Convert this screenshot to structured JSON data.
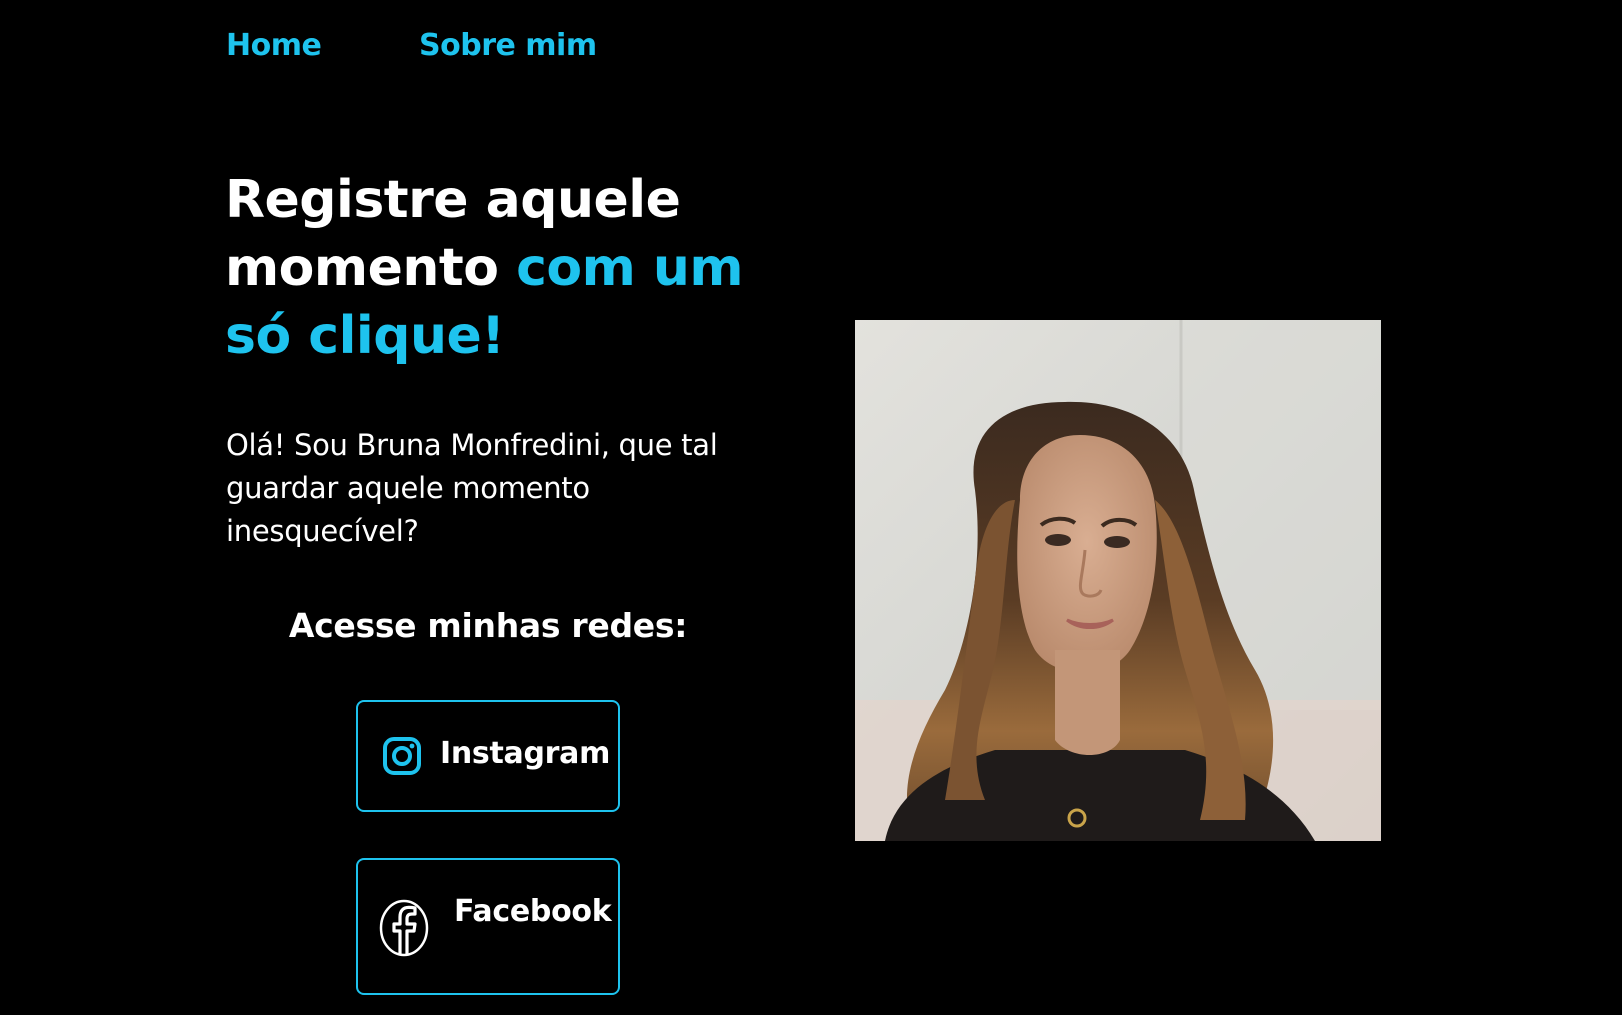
{
  "nav": {
    "items": [
      {
        "label": "Home"
      },
      {
        "label": "Sobre mim"
      }
    ]
  },
  "hero": {
    "headline_white": "Registre aquele momento",
    "headline_accent": "com um só clique!",
    "intro": "Olá! Sou Bruna Monfredini, que tal guardar aquele momento inesquecível?"
  },
  "social": {
    "title": "Acesse minhas redes:",
    "buttons": [
      {
        "label": "Instagram",
        "icon": "instagram-icon"
      },
      {
        "label": "Facebook",
        "icon": "facebook-icon"
      }
    ]
  },
  "colors": {
    "background": "#000000",
    "accent": "#1ec3ee",
    "text": "#ffffff"
  }
}
